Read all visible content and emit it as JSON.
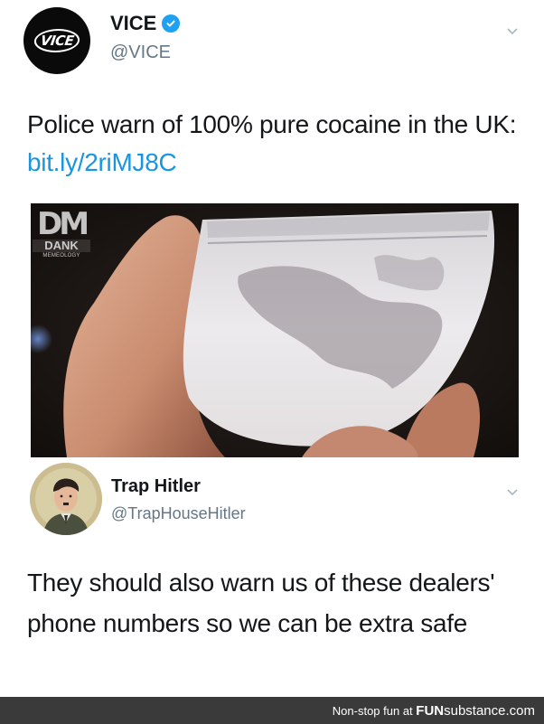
{
  "tweet1": {
    "avatar_logo": "VICE",
    "name": "VICE",
    "handle": "@VICE",
    "verified": true,
    "text": "Police warn of 100% pure cocaine in the UK: ",
    "link": "bit.ly/2riMJ8C",
    "media_watermark": {
      "logo": "DM",
      "name": "DANK",
      "sub": "MEMEOLOGY"
    }
  },
  "tweet2": {
    "name": "Trap Hitler",
    "handle": "@TrapHouseHitler",
    "text": "They should also warn us of these dealers' phone numbers so we can be extra safe"
  },
  "footer": {
    "prefix": "Non-stop fun at ",
    "brand_bold": "FUN",
    "brand_rest": "substance.com"
  },
  "colors": {
    "link": "#1b95e0",
    "handle": "#657786",
    "verified": "#1da1f2",
    "footer_bg": "#3a3a3a"
  },
  "icons": [
    "verified-badge-icon",
    "chevron-down-icon",
    "chevron-down-icon"
  ]
}
